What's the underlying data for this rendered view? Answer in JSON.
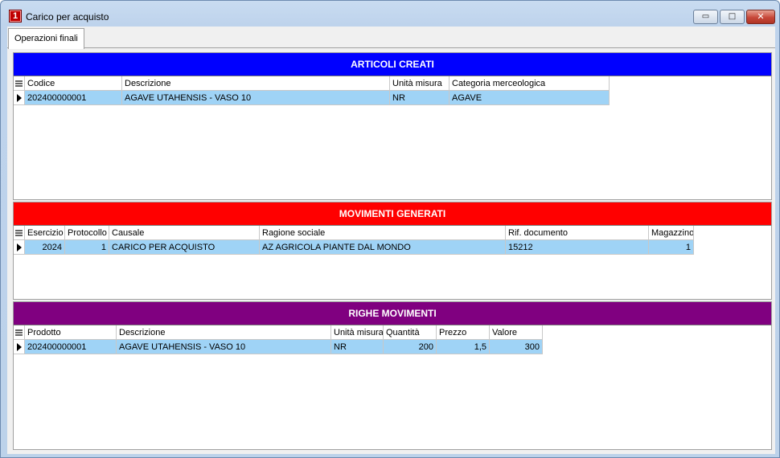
{
  "window": {
    "title": "Carico per acquisto",
    "icon_label": "1",
    "buttons": {
      "minimize": "▭",
      "maximize": "□",
      "close": "✕"
    }
  },
  "tabs": [
    {
      "label": "Operazioni finali"
    }
  ],
  "colors": {
    "articoli_header": "#0000ff",
    "movimenti_header": "#ff0000",
    "righe_header": "#800080",
    "selected_row": "#9fd3f6"
  },
  "articoli": {
    "title": "ARTICOLI CREATI",
    "columns": [
      "Codice",
      "Descrizione",
      "Unità misura",
      "Categoria merceologica"
    ],
    "rows": [
      [
        "202400000001",
        "AGAVE UTAHENSIS - VASO 10",
        "NR",
        "AGAVE"
      ]
    ]
  },
  "movimenti": {
    "title": "MOVIMENTI GENERATI",
    "columns": [
      "Esercizio",
      "Protocollo",
      "Causale",
      "Ragione sociale",
      "Rif. documento",
      "Magazzino"
    ],
    "rows": [
      [
        "2024",
        "1",
        "CARICO PER ACQUISTO",
        "AZ AGRICOLA PIANTE DAL MONDO",
        "15212",
        "1"
      ]
    ]
  },
  "righe": {
    "title": "RIGHE MOVIMENTI",
    "columns": [
      "Prodotto",
      "Descrizione",
      "Unità misura",
      "Quantità",
      "Prezzo",
      "Valore"
    ],
    "rows": [
      [
        "202400000001",
        "AGAVE UTAHENSIS - VASO 10",
        "NR",
        "200",
        "1,5",
        "300"
      ]
    ]
  }
}
